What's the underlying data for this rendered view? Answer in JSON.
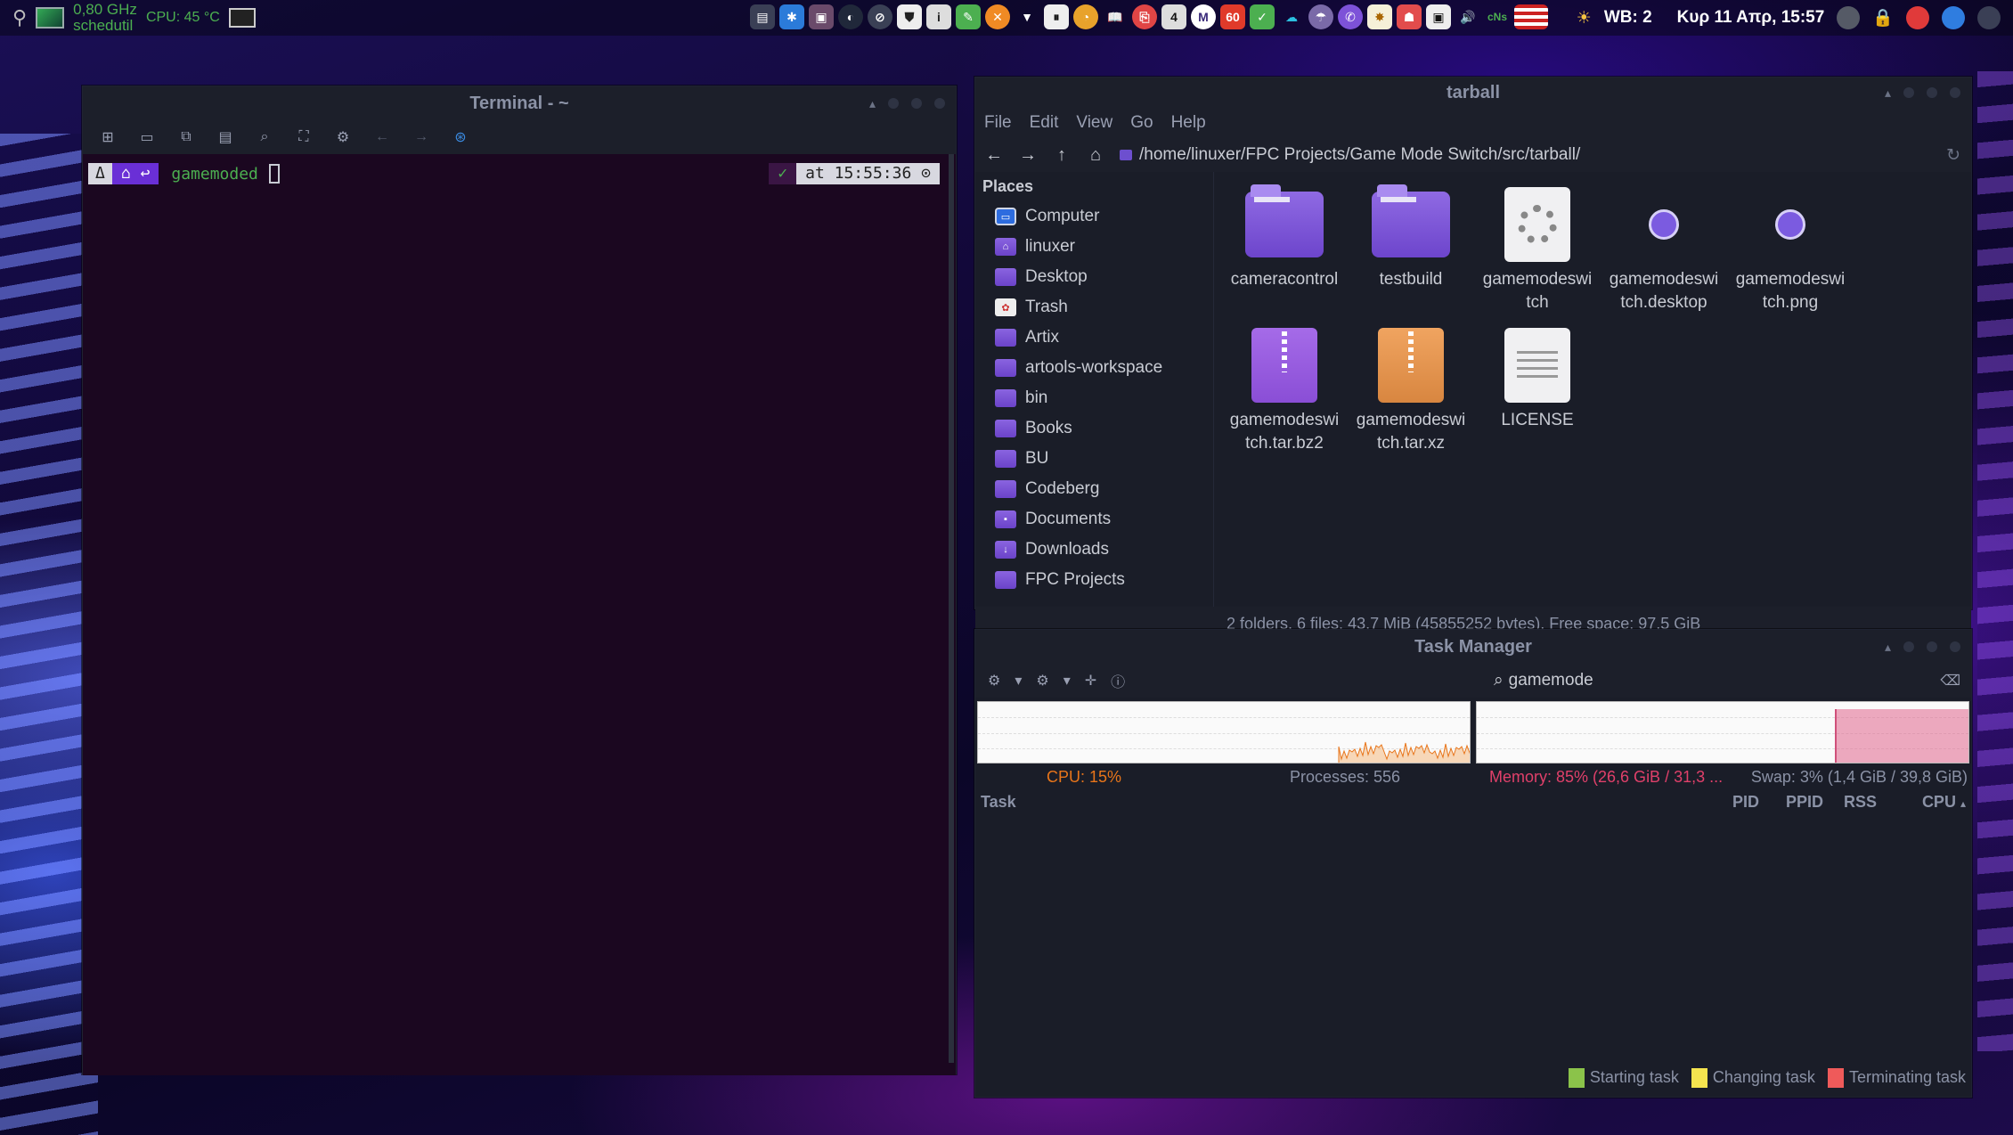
{
  "panel": {
    "cpu_freq": "0,80 GHz",
    "governor": "schedutil",
    "cpu_temp": "CPU: 45 °C",
    "tray_badges": [
      "4",
      "M",
      "60"
    ],
    "workspace": "WB: 2",
    "datetime": "Κυρ 11 Απρ, 15:57",
    "icons": [
      "usb-icon",
      "system-monitor-icon",
      "screen-icon",
      "tray-app-icon",
      "bluetooth-icon",
      "tray-icon",
      "steam-icon",
      "security-icon",
      "info-icon",
      "notes-icon",
      "cancel-icon",
      "wifi-icon",
      "media-icon",
      "alarm-icon",
      "book-icon",
      "pdf-icon",
      "badge-icon",
      "mega-icon",
      "counter-icon",
      "check-icon",
      "cloud-icon",
      "weather-icon",
      "viber-icon",
      "settings-icon",
      "game-icon",
      "phone-icon",
      "volume-icon",
      "network-icon",
      "flag-icon",
      "weather-sun-icon",
      "moon-icon",
      "lock-icon",
      "power-icon",
      "browser-icon"
    ],
    "colors": {
      "freq_green": "#4caf50"
    }
  },
  "terminal": {
    "title": "Terminal - ~",
    "prompt_os": "Δ",
    "prompt_dir": "⌂ ↩",
    "command": "gamemoded",
    "right_ok": "✓",
    "right_time": "at 15:55:36 ⊙"
  },
  "filemgr": {
    "title": "tarball",
    "menu": [
      "File",
      "Edit",
      "View",
      "Go",
      "Help"
    ],
    "path": "/home/linuxer/FPC Projects/Game Mode Switch/src/tarball/",
    "places_heading": "Places",
    "places": [
      {
        "label": "Computer",
        "icon": "computer"
      },
      {
        "label": "linuxer",
        "icon": "home"
      },
      {
        "label": "Desktop",
        "icon": "desktop"
      },
      {
        "label": "Trash",
        "icon": "trash"
      },
      {
        "label": "Artix",
        "icon": "folder"
      },
      {
        "label": "artools-workspace",
        "icon": "folder"
      },
      {
        "label": "bin",
        "icon": "folder"
      },
      {
        "label": "Books",
        "icon": "folder"
      },
      {
        "label": "BU",
        "icon": "folder"
      },
      {
        "label": "Codeberg",
        "icon": "folder"
      },
      {
        "label": "Documents",
        "icon": "documents"
      },
      {
        "label": "Downloads",
        "icon": "downloads"
      },
      {
        "label": "FPC Projects",
        "icon": "folder"
      }
    ],
    "files": [
      {
        "name1": "cameracontrol",
        "name2": "",
        "type": "folder"
      },
      {
        "name1": "testbuild",
        "name2": "",
        "type": "folder"
      },
      {
        "name1": "gamemodeswi",
        "name2": "tch",
        "type": "executable"
      },
      {
        "name1": "gamemodeswi",
        "name2": "tch.desktop",
        "type": "desktop"
      },
      {
        "name1": "gamemodeswi",
        "name2": "tch.png",
        "type": "image"
      },
      {
        "name1": "gamemodeswi",
        "name2": "tch.tar.bz2",
        "type": "archive-bz2"
      },
      {
        "name1": "gamemodeswi",
        "name2": "tch.tar.xz",
        "type": "archive-xz"
      },
      {
        "name1": "LICENSE",
        "name2": "",
        "type": "text"
      }
    ],
    "status": "2 folders, 6 files: 43,7 MiB (45855252 bytes), Free space: 97,5 GiB"
  },
  "taskmgr": {
    "title": "Task Manager",
    "search_value": "gamemode",
    "cpu": "CPU: 15%",
    "processes": "Processes: 556",
    "memory": "Memory: 85% (26,6 GiB / 31,3 ...",
    "swap": "Swap: 3% (1,4 GiB / 39,8 GiB)",
    "columns": {
      "task": "Task",
      "pid": "PID",
      "ppid": "PPID",
      "rss": "RSS",
      "cpu": "CPU"
    },
    "legend": {
      "starting": "Starting task",
      "changing": "Changing task",
      "terminating": "Terminating task"
    },
    "colors": {
      "cpu": "#e8751a",
      "memory": "#e0406a",
      "starting": "#8bc34a",
      "changing": "#f5e44f",
      "terminating": "#ef5a5a"
    },
    "memory_level": 0.85
  }
}
